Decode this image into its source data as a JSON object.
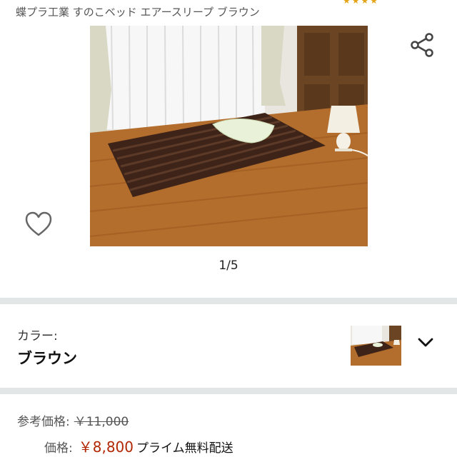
{
  "product": {
    "title": "蝶プラ工業 すのこベッド エアースリープ ブラウン",
    "image_counter": "1/5"
  },
  "color": {
    "label": "カラー:",
    "value": "ブラウン"
  },
  "pricing": {
    "reference_label": "参考価格:",
    "reference_price": "￥11,000",
    "price_label": "価格:",
    "price": "￥8,800",
    "shipping": "プライム無料配送"
  },
  "icons": {
    "share": "share-icon",
    "wishlist": "heart-icon",
    "dropdown": "chevron-down-icon"
  },
  "colors": {
    "price": "#b12704",
    "separator": "#e3e6e6"
  }
}
